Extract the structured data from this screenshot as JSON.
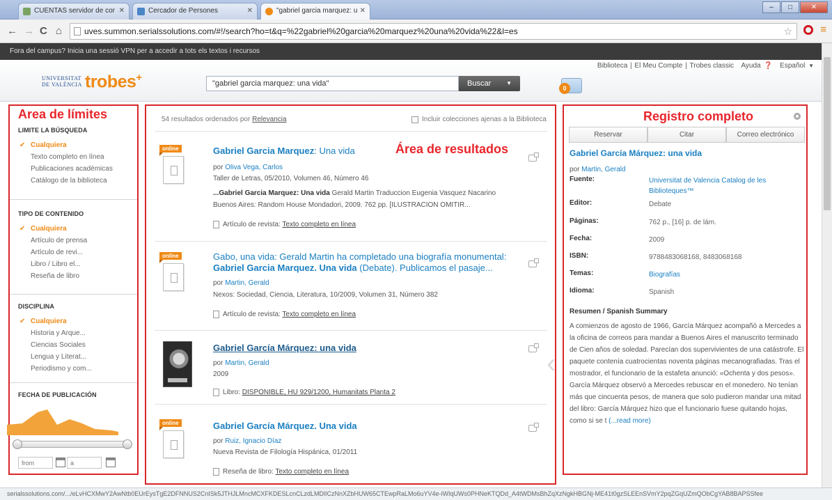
{
  "browser": {
    "tabs": [
      {
        "label": "CUENTAS servidor de cor",
        "active": false
      },
      {
        "label": "Cercador de Persones",
        "active": false
      },
      {
        "label": "\"gabriel garcia marquez: u",
        "active": true
      }
    ],
    "url": "uves.summon.serialssolutions.com/#!/search?ho=t&q=%22gabriel%20garcia%20marquez%20una%20vida%22&l=es",
    "status_url": "serialssolutions.com/.../eLvHCXMwY2AwNtb0EUrEysTgE2DFNNUS2CnISk5JTHJLMncMCXFKDESLcnCLzdLMDlICzNnXZbHUW65CTEwpRaLMo6uYV4e-iWIqUWs0PHNeKTQDd_A4tWDMsBhZqXzNgkHBGNj-ME41t0gzSLEEnSVmY2pqZGqUZmQObCgYAB8BAPSSfee"
  },
  "page": {
    "vpn_notice": "Fora del campus? Inicia una sessió VPN per a accedir a tots els textos i recursos",
    "logo_uv_line1": "UNIVERSITAT",
    "logo_uv_line2": "DE VALÈNCIA",
    "logo_text": "trobes",
    "logo_plus": "+",
    "search_value": "\"gabriel garcia marquez: una vida\"",
    "search_button": "Buscar",
    "toplinks": [
      "Biblioteca",
      "El Meu Compte",
      "Trobes classic",
      "Ayuda",
      "Español"
    ],
    "folder_count": "0"
  },
  "left": {
    "region_title": "Area de límites",
    "facets": [
      {
        "heading": "LIMITE LA BÚSQUEDA",
        "items": [
          "Cualquiera",
          "Texto completo en línea",
          "Publicaciones académicas",
          "Catálogo de la biblioteca"
        ]
      },
      {
        "heading": "TIPO DE CONTENIDO",
        "items": [
          "Cualquiera",
          "Artículo de prensa",
          "Artículo de revi...",
          "Libro / Libro el...",
          "Reseña de libro"
        ]
      },
      {
        "heading": "DISCIPLINA",
        "items": [
          "Cualquiera",
          "Historia y Arque...",
          "Ciencias Sociales",
          "Lengua y Literat...",
          "Periodismo y com..."
        ]
      },
      {
        "heading": "FECHA DE PUBLICACIÓN",
        "items": []
      }
    ],
    "date_from_placeholder": "from",
    "date_to_placeholder": "a"
  },
  "middle": {
    "region_title": "Área de resultados",
    "count_text": "54 resultados ordenados por",
    "sort_label": "Relevancia",
    "include_label": "Incluir colecciones ajenas a la Biblioteca",
    "results": [
      {
        "badge": "online",
        "title_parts": [
          "Gabriel Garcia Marquez",
          ": Una vida"
        ],
        "authors_prefix": "por",
        "authors": "Oliva Vega, Carlos",
        "source": "Taller de Letras, 05/2010, Volumen 46, Número 46",
        "snippet_bold": "...Gabriel Garcia Marquez: Una vida",
        "snippet": " Gerald Martin Traduccion Eugenia Vasquez Nacarino Buenos Aires: Random House Mondadori, 2009. 762 pp. [ILUSTRACION OMITIR...",
        "format_label": "Artículo de revista:",
        "format_link": "Texto completo en línea"
      },
      {
        "badge": "online",
        "title_line1": "Gabo, una vida: Gerald Martin ha completado una biografía monumental:",
        "title_bold": "Gabriel Garcia Marquez. Una vida",
        "title_tail": " (Debate). Publicamos el pasaje...",
        "authors_prefix": "por",
        "authors": "Martin, Gerald",
        "source": "Nexos: Sociedad, Ciencia, Literatura, 10/2009, Volumen 31, Número 382",
        "format_label": "Artículo de revista:",
        "format_link": "Texto completo en línea"
      },
      {
        "title": "Gabriel García Márquez: una vida",
        "authors_prefix": "por",
        "authors": "Martin, Gerald",
        "source": "2009",
        "format_label": "Libro:",
        "format_link": "DISPONIBLE, HU 929/1200, Humanitats Planta 2"
      },
      {
        "badge": "online",
        "title": "Gabriel García Márquez. Una vida",
        "authors_prefix": "por",
        "authors": "Ruiz, Ignacio Díaz",
        "source": "Nueva Revista de Filología Hispánica, 01/2011",
        "format_label": "Reseña de libro:",
        "format_link": "Texto completo en línea"
      }
    ]
  },
  "right": {
    "region_title": "Registro completo",
    "actions": [
      "Reservar",
      "Citar",
      "Correo electrónico"
    ],
    "title": "Gabriel García Márquez: una vida",
    "authors_prefix": "por",
    "authors": "Martin, Gerald",
    "fields": [
      {
        "label": "Fuente:",
        "value": "Universitat de Valencia Catalog de les Biblioteques™",
        "link": true
      },
      {
        "label": "Editor:",
        "value": "Debate",
        "link": false
      },
      {
        "label": "Páginas:",
        "value": "762 p., [16] p. de lám.",
        "link": false
      },
      {
        "label": "Fecha:",
        "value": "2009",
        "link": false
      },
      {
        "label": "ISBN:",
        "value": "9788483068168, 8483068168",
        "link": false
      },
      {
        "label": "Temas:",
        "value": "Biografías",
        "link": true
      },
      {
        "label": "Idioma:",
        "value": "Spanish",
        "link": false
      }
    ],
    "abstract_heading": "Resumen / Spanish Summary",
    "abstract": "A comienzos de agosto de 1966, García Márquez acompañó a Mercedes a la oficina de correos para mandar a Buenos Aires el manuscrito terminado de Cien años de soledad. Parecían dos supervivientes de una catástrofe. El paquete contenía cuatrocientas noventa páginas mecanografiadas. Tras el mostrador, el funcionario de la estafeta anunció: «Ochenta y dos pesos». García Márquez observó a Mercedes rebuscar en el monedero. No tenían más que cincuenta pesos, de manera que solo pudieron mandar una mitad del libro: García Márquez hizo que el funcionario fuese quitando hojas, como si se t",
    "abstract_more": "(...read more)"
  }
}
